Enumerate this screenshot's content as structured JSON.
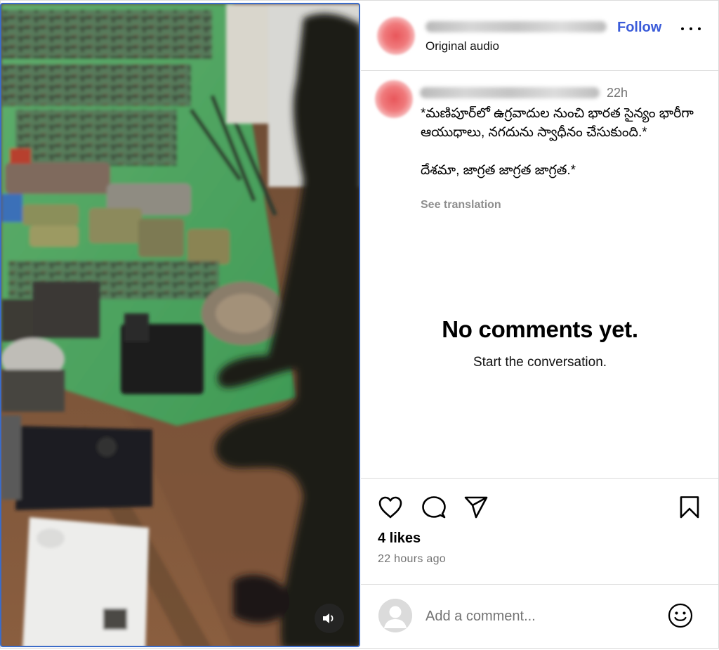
{
  "header": {
    "username": "sri_janatha_shoes_mart",
    "follow_label": "Follow",
    "audio_label": "Original audio",
    "more_icon": "more-options-icon"
  },
  "caption": {
    "username": "sri_janatha_shoes_mart",
    "time_ago": "22h",
    "text": "*మణిపూర్‌లో ఉగ్రవాదుల నుంచి భారత సైన్యం భారీగా ఆయుధాలు, నగదును స్వాధీనం చేసుకుంది.*\n\nదేశమా, జాగ్రత జాగ్రత జాగ్రత.*",
    "see_translation": "See translation"
  },
  "empty_comments": {
    "title": "No comments yet.",
    "subtitle": "Start the conversation."
  },
  "actions": {
    "like_icon": "heart-icon",
    "comment_icon": "comment-icon",
    "share_icon": "share-icon",
    "save_icon": "bookmark-icon",
    "likes": "4 likes",
    "posted": "22 hours ago"
  },
  "comment_box": {
    "placeholder": "Add a comment...",
    "emoji_icon": "emoji-icon"
  },
  "media": {
    "mute_icon": "speaker-icon"
  },
  "colors": {
    "follow": "#3a5bd9",
    "divider": "#dbdbdb",
    "muted_text": "#737373"
  }
}
